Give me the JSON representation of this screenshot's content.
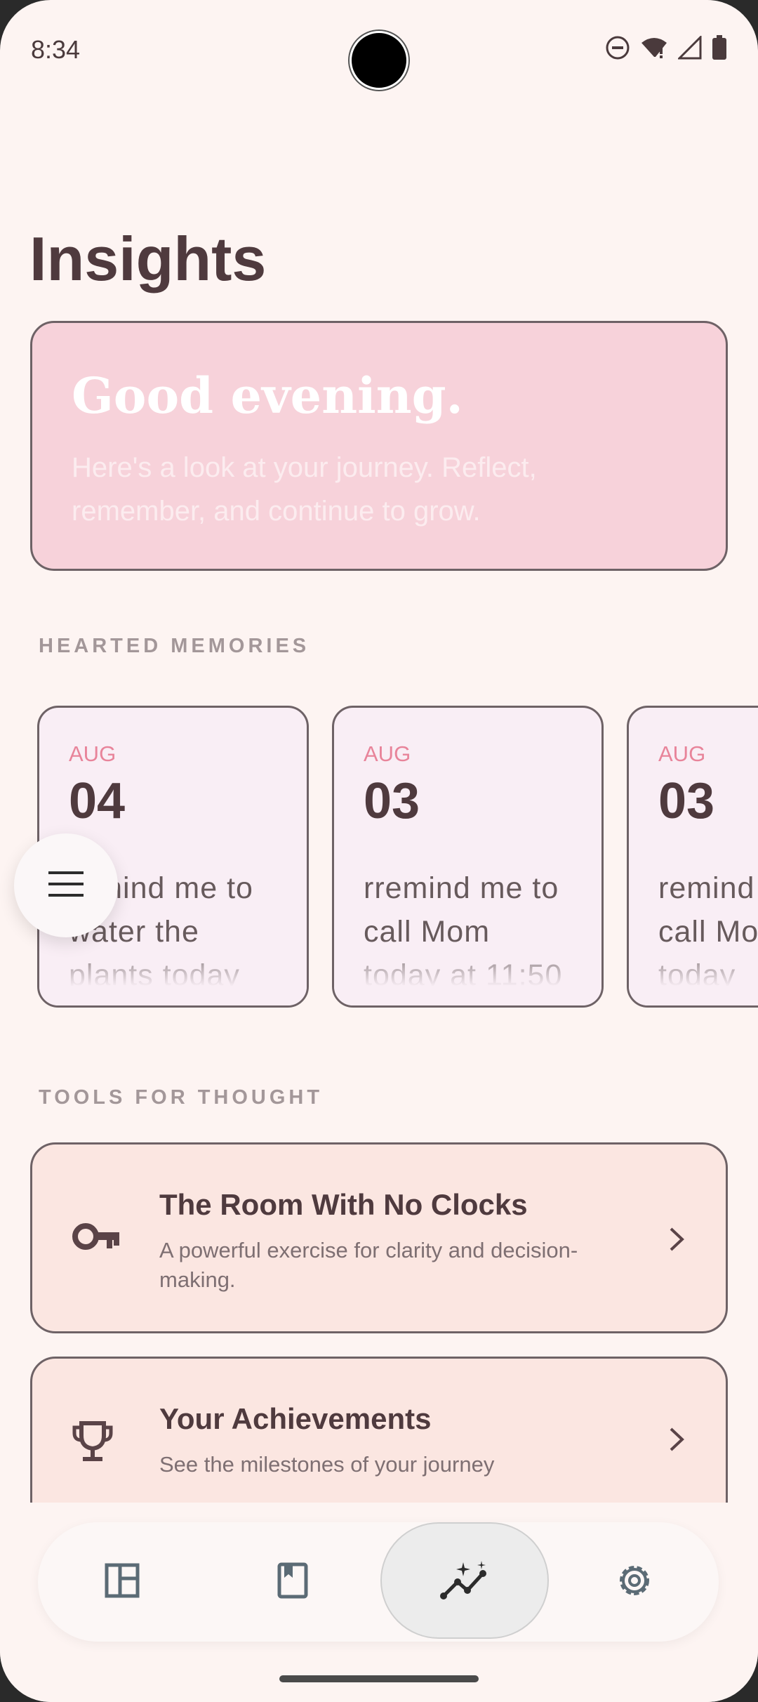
{
  "status_bar": {
    "time": "8:34"
  },
  "page": {
    "title": "Insights"
  },
  "greeting": {
    "title": "Good evening.",
    "text": "Here's a look at your journey. Reflect, remember, and continue to grow."
  },
  "hearted_memories": {
    "label": "HEARTED MEMORIES",
    "items": [
      {
        "month": "AUG",
        "day": "04",
        "text": "remind me to water the plants today"
      },
      {
        "month": "AUG",
        "day": "03",
        "text": "rremind me to call Mom today at 11:50"
      },
      {
        "month": "AUG",
        "day": "03",
        "text": "remind me to call Mom today"
      }
    ]
  },
  "tools": {
    "label": "TOOLS FOR THOUGHT",
    "items": [
      {
        "title": "The Room With No Clocks",
        "description": "A powerful exercise for clarity and decision-making.",
        "icon": "key-icon"
      },
      {
        "title": "Your Achievements",
        "description": "See the milestones of your journey",
        "icon": "trophy-icon"
      }
    ]
  },
  "bottom_nav": {
    "items": [
      "dashboard-icon",
      "journal-icon",
      "insights-icon",
      "settings-icon"
    ],
    "active": "insights-icon"
  },
  "colors": {
    "background": "#fdf4f2",
    "greeting_card": "#f7d2da",
    "tool_card": "#fbe6e1",
    "accent_month": "#e8849a",
    "title_text": "#4f3a3e"
  }
}
